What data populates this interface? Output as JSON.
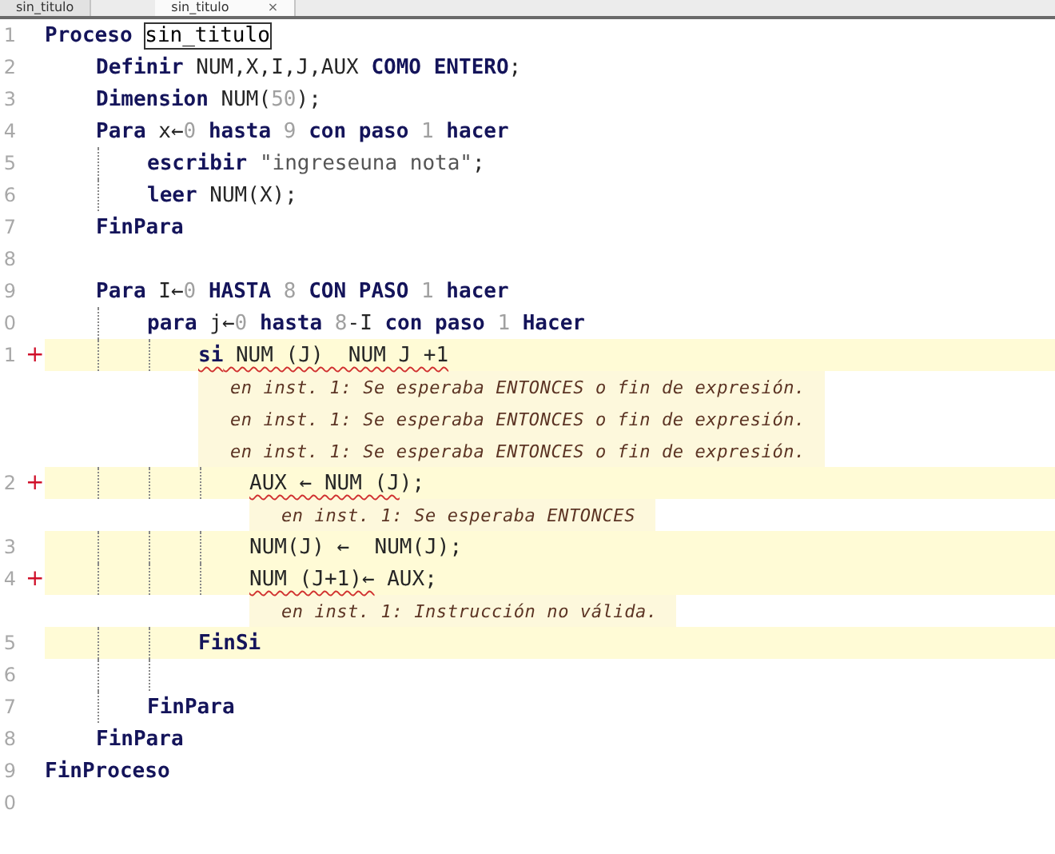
{
  "tabs": [
    {
      "label": "sin_titulo",
      "selected": false
    },
    {
      "label": "sin_titulo",
      "selected": true,
      "close": "×"
    }
  ],
  "lines": [
    {
      "number": "1",
      "segments": [
        {
          "kind": "keyword",
          "text": "Proceso "
        },
        {
          "kind": "boxed",
          "text": "sin_titulo"
        }
      ],
      "children": [
        {
          "number": "2",
          "segments": [
            {
              "kind": "keyword",
              "text": "Definir"
            },
            {
              "kind": "plain",
              "text": " NUM,X,I,J,AUX "
            },
            {
              "kind": "keyword",
              "text": "COMO ENTERO"
            },
            {
              "kind": "plain",
              "text": ";"
            }
          ]
        },
        {
          "number": "3",
          "segments": [
            {
              "kind": "keyword",
              "text": "Dimension"
            },
            {
              "kind": "plain",
              "text": " NUM("
            },
            {
              "kind": "number",
              "text": "50"
            },
            {
              "kind": "plain",
              "text": ");"
            }
          ]
        },
        {
          "number": "4",
          "segments": [
            {
              "kind": "keyword",
              "text": "Para"
            },
            {
              "kind": "plain",
              "text": " x←"
            },
            {
              "kind": "number",
              "text": "0"
            },
            {
              "kind": "keyword",
              "text": " hasta "
            },
            {
              "kind": "number",
              "text": "9"
            },
            {
              "kind": "keyword",
              "text": " con paso "
            },
            {
              "kind": "number",
              "text": "1"
            },
            {
              "kind": "keyword",
              "text": " hacer"
            }
          ],
          "children": [
            {
              "number": "5",
              "segments": [
                {
                  "kind": "keyword",
                  "text": "escribir "
                },
                {
                  "kind": "string",
                  "text": "\"ingreseuna nota\""
                },
                {
                  "kind": "plain",
                  "text": ";"
                }
              ]
            },
            {
              "number": "6",
              "segments": [
                {
                  "kind": "keyword",
                  "text": "leer"
                },
                {
                  "kind": "plain",
                  "text": " NUM(X);"
                }
              ]
            }
          ]
        },
        {
          "number": "7",
          "segments": [
            {
              "kind": "keyword",
              "text": "FinPara"
            }
          ]
        },
        {
          "number": "8"
        },
        {
          "number": "9",
          "segments": [
            {
              "kind": "keyword",
              "text": "Para"
            },
            {
              "kind": "plain",
              "text": " I←"
            },
            {
              "kind": "number",
              "text": "0"
            },
            {
              "kind": "keyword",
              "text": " HASTA "
            },
            {
              "kind": "number",
              "text": "8"
            },
            {
              "kind": "keyword",
              "text": " CON PASO "
            },
            {
              "kind": "number",
              "text": "1"
            },
            {
              "kind": "keyword",
              "text": " hacer"
            }
          ],
          "children": [
            {
              "number": "0",
              "segments": [
                {
                  "kind": "keyword",
                  "text": "para"
                },
                {
                  "kind": "plain",
                  "text": " j←"
                },
                {
                  "kind": "number",
                  "text": "0"
                },
                {
                  "kind": "keyword",
                  "text": " hasta "
                },
                {
                  "kind": "number",
                  "text": "8"
                },
                {
                  "kind": "plain",
                  "text": "-I"
                },
                {
                  "kind": "keyword",
                  "text": " con paso "
                },
                {
                  "kind": "number",
                  "text": "1"
                },
                {
                  "kind": "keyword",
                  "text": " Hacer"
                }
              ],
              "children": [
                {
                  "number": "1",
                  "marker": "+",
                  "highlighted": true,
                  "segments": [
                    {
                      "kind": "keyword",
                      "text": "si",
                      "wavy": true
                    },
                    {
                      "kind": "plain",
                      "text": " NUM (J)  NUM J +1",
                      "wavy": true
                    }
                  ],
                  "errors": [
                    "en inst. 1: Se esperaba ENTONCES o fin de expresión.",
                    "en inst. 1: Se esperaba ENTONCES o fin de expresión.",
                    "en inst. 1: Se esperaba ENTONCES o fin de expresión."
                  ],
                  "children": [
                    {
                      "number": "2",
                      "marker": "+",
                      "highlighted": true,
                      "segments": [
                        {
                          "kind": "plain",
                          "text": "AUX ← NUM (J",
                          "wavy": true
                        },
                        {
                          "kind": "plain",
                          "text": ");"
                        }
                      ],
                      "errors": [
                        "en inst. 1: Se esperaba ENTONCES"
                      ]
                    },
                    {
                      "number": "3",
                      "highlighted": true,
                      "segments": [
                        {
                          "kind": "plain",
                          "text": "NUM(J) ←  NUM(J);"
                        }
                      ]
                    },
                    {
                      "number": "4",
                      "marker": "+",
                      "highlighted": true,
                      "segments": [
                        {
                          "kind": "plain",
                          "text": "NUM (J+1)←",
                          "wavy": true
                        },
                        {
                          "kind": "plain",
                          "text": " AUX;"
                        }
                      ],
                      "errors": [
                        "en inst. 1: Instrucción no válida."
                      ]
                    }
                  ]
                },
                {
                  "number": "5",
                  "highlighted": true,
                  "segments": [
                    {
                      "kind": "keyword",
                      "text": "FinSi"
                    }
                  ]
                },
                {
                  "number": "6"
                }
              ]
            },
            {
              "number": "7",
              "segments": [
                {
                  "kind": "keyword",
                  "text": "FinPara"
                }
              ]
            }
          ]
        },
        {
          "number": "8",
          "segments": [
            {
              "kind": "keyword",
              "text": "FinPara"
            }
          ]
        }
      ]
    },
    {
      "number": "9",
      "segments": [
        {
          "kind": "keyword",
          "text": "FinProceso"
        }
      ]
    },
    {
      "number": "0"
    }
  ]
}
